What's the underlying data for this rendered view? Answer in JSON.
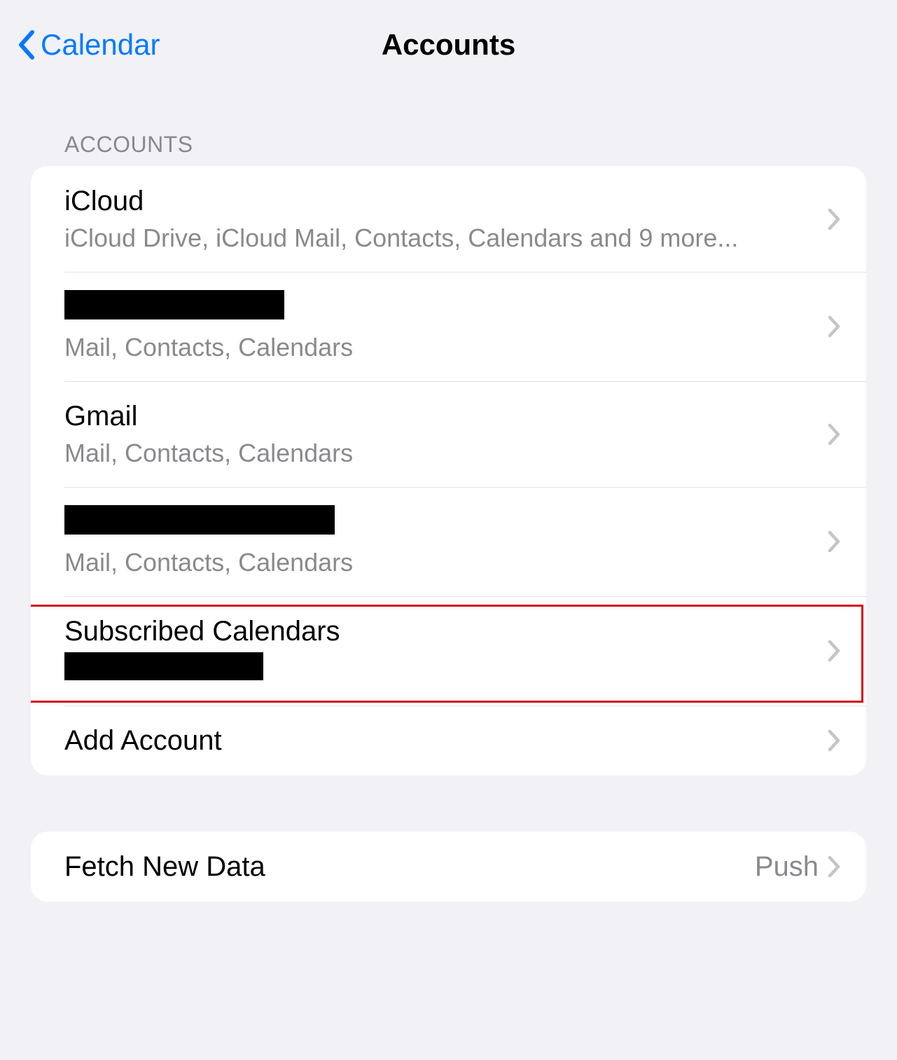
{
  "nav": {
    "back_label": "Calendar",
    "title": "Accounts"
  },
  "sections": {
    "accounts_header": "ACCOUNTS",
    "items": [
      {
        "title": "iCloud",
        "subtitle": "iCloud Drive, iCloud Mail, Contacts, Calendars and 9 more..."
      },
      {
        "title": "",
        "subtitle": "Mail, Contacts, Calendars",
        "redacted_title": true
      },
      {
        "title": "Gmail",
        "subtitle": "Mail, Contacts, Calendars"
      },
      {
        "title": "",
        "subtitle": "Mail, Contacts, Calendars",
        "redacted_title": true
      },
      {
        "title": "Subscribed Calendars",
        "subtitle": "",
        "redacted_subtitle": true,
        "highlighted": true
      }
    ],
    "add_account_label": "Add Account"
  },
  "fetch": {
    "label": "Fetch New Data",
    "value": "Push"
  },
  "icons": {
    "chevron_left": "chevron-left-icon",
    "chevron_right": "chevron-right-icon"
  },
  "colors": {
    "accent": "#007aff",
    "highlight": "#d10e12",
    "bg": "#f2f1f6",
    "secondary_text": "#8a8a8e"
  }
}
